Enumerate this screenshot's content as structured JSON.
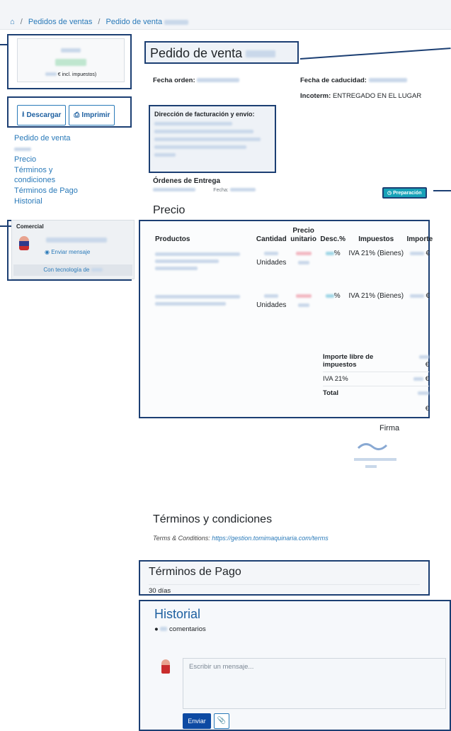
{
  "breadcrumb": {
    "home_icon": "home-icon",
    "items": [
      "Pedidos de ventas",
      "Pedido de venta"
    ]
  },
  "sidebar": {
    "amount_note": "€ incl. impuestos)",
    "download_label": "Descargar",
    "print_label": "Imprimir",
    "nav": [
      "Pedido de venta",
      "Precio",
      "Términos y condiciones",
      "Términos de Pago",
      "Historial"
    ],
    "commercial_title": "Comercial",
    "send_message": "Enviar mensaje",
    "powered_by": "Con tecnología de"
  },
  "order": {
    "title": "Pedido de venta",
    "order_date_label": "Fecha orden:",
    "expiry_label": "Fecha de caducidad:",
    "incoterm_label": "Incoterm:",
    "incoterm_value": "ENTREGADO EN EL LUGAR",
    "address_heading": "Dirección de facturación y envío:",
    "deliveries_heading": "Órdenes de Entrega",
    "delivery_date_label": "Fecha:",
    "delivery_status": "Preparación"
  },
  "price": {
    "heading": "Precio",
    "columns": [
      "Productos",
      "Cantidad",
      "Precio unitario",
      "Desc.%",
      "Impuestos",
      "Importe"
    ],
    "rows": [
      {
        "unit": "Unidades",
        "tax": "IVA 21% (Bienes)",
        "currency": "€",
        "disc_suffix": "%"
      },
      {
        "unit": "Unidades",
        "tax": "IVA 21% (Bienes)",
        "currency": "€",
        "disc_suffix": "%"
      }
    ],
    "totals": {
      "untaxed_label": "Importe libre de impuestos",
      "tax_label": "IVA 21%",
      "total_label": "Total",
      "currency": "€"
    },
    "signature_label": "Firma"
  },
  "terms": {
    "heading": "Términos y condiciones",
    "text_prefix": "Terms & Conditions:",
    "url": "https://gestion.tomimaquinaria.com/terms"
  },
  "payment": {
    "heading": "Términos de Pago",
    "value": "30 días"
  },
  "history": {
    "heading": "Historial",
    "comments_label": "comentarios",
    "placeholder": "Escribir un mensaje...",
    "send_label": "Enviar"
  }
}
